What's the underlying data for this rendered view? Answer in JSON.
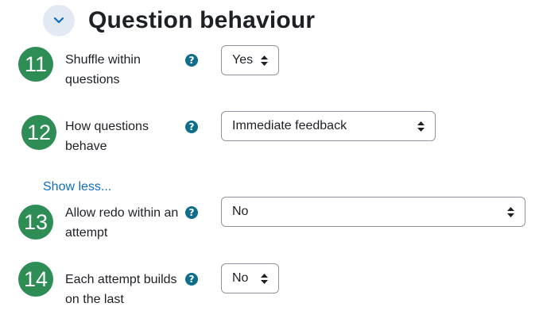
{
  "section": {
    "title": "Question behaviour",
    "toggle_icon": "chevron-down-icon"
  },
  "fields": [
    {
      "number": "11",
      "label_line1": "Shuffle within",
      "label_line2": "questions",
      "help": "?",
      "value": "Yes"
    },
    {
      "number": "12",
      "label_line1": "How questions",
      "label_line2": "behave",
      "help": "?",
      "value": "Immediate feedback"
    },
    {
      "number": "13",
      "label_line1": "Allow redo within an",
      "label_line2": "attempt",
      "help": "?",
      "value": "No"
    },
    {
      "number": "14",
      "label_line1": "Each attempt builds",
      "label_line2": "on the last",
      "help": "?",
      "value": "No"
    }
  ],
  "show_less": "Show less...",
  "colors": {
    "accent_green": "#2e8c55",
    "help_teal": "#0f6e8c",
    "link_blue": "#0f6cbf",
    "toggle_bg": "#e3e9f2"
  }
}
